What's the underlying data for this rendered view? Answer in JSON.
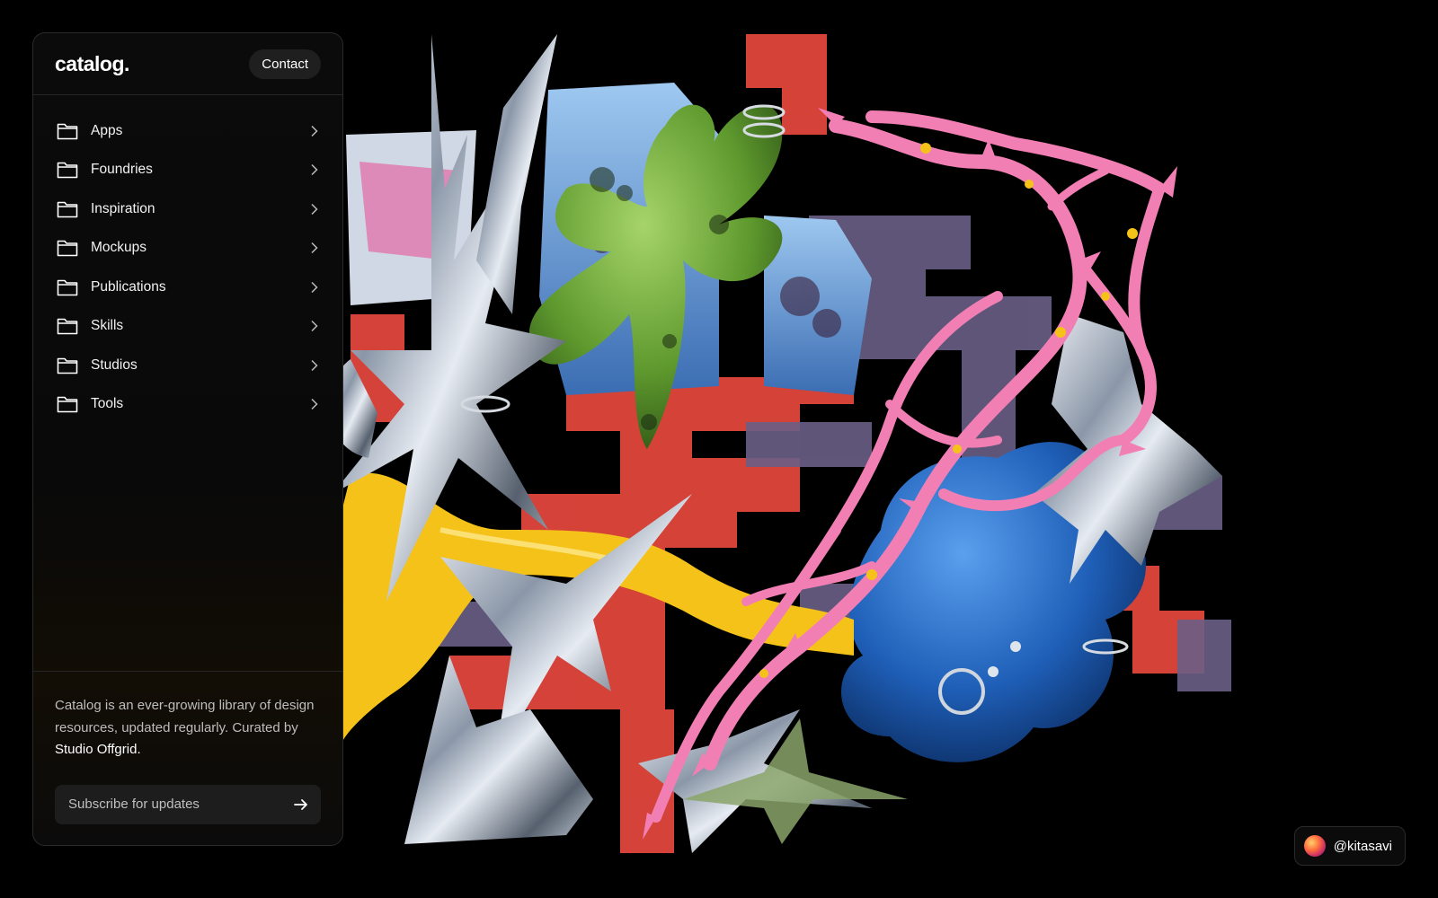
{
  "brand": {
    "logo": "catalog."
  },
  "header": {
    "contact_label": "Contact"
  },
  "nav": {
    "items": [
      {
        "label": "Apps",
        "icon": "folder-icon"
      },
      {
        "label": "Foundries",
        "icon": "folder-icon"
      },
      {
        "label": "Inspiration",
        "icon": "folder-icon"
      },
      {
        "label": "Mockups",
        "icon": "folder-icon"
      },
      {
        "label": "Publications",
        "icon": "folder-icon"
      },
      {
        "label": "Skills",
        "icon": "folder-icon"
      },
      {
        "label": "Studios",
        "icon": "folder-icon"
      },
      {
        "label": "Tools",
        "icon": "folder-icon"
      }
    ]
  },
  "footer": {
    "about_text": "Catalog is an ever-growing library of design resources, updated regularly. Curated by ",
    "curator": "Studio Offgrid.",
    "subscribe_placeholder": "Subscribe for updates"
  },
  "credit": {
    "handle": "@kitasavi"
  },
  "colors": {
    "background": "#000000",
    "panel": "#0b0b0b",
    "border": "#2a2a2a",
    "pink": "#f27fb4",
    "yellow": "#f5c21a",
    "blue": "#2a6fc9",
    "green": "#6fa83a",
    "red": "#e0463c",
    "chrome": "#c8d2de"
  }
}
